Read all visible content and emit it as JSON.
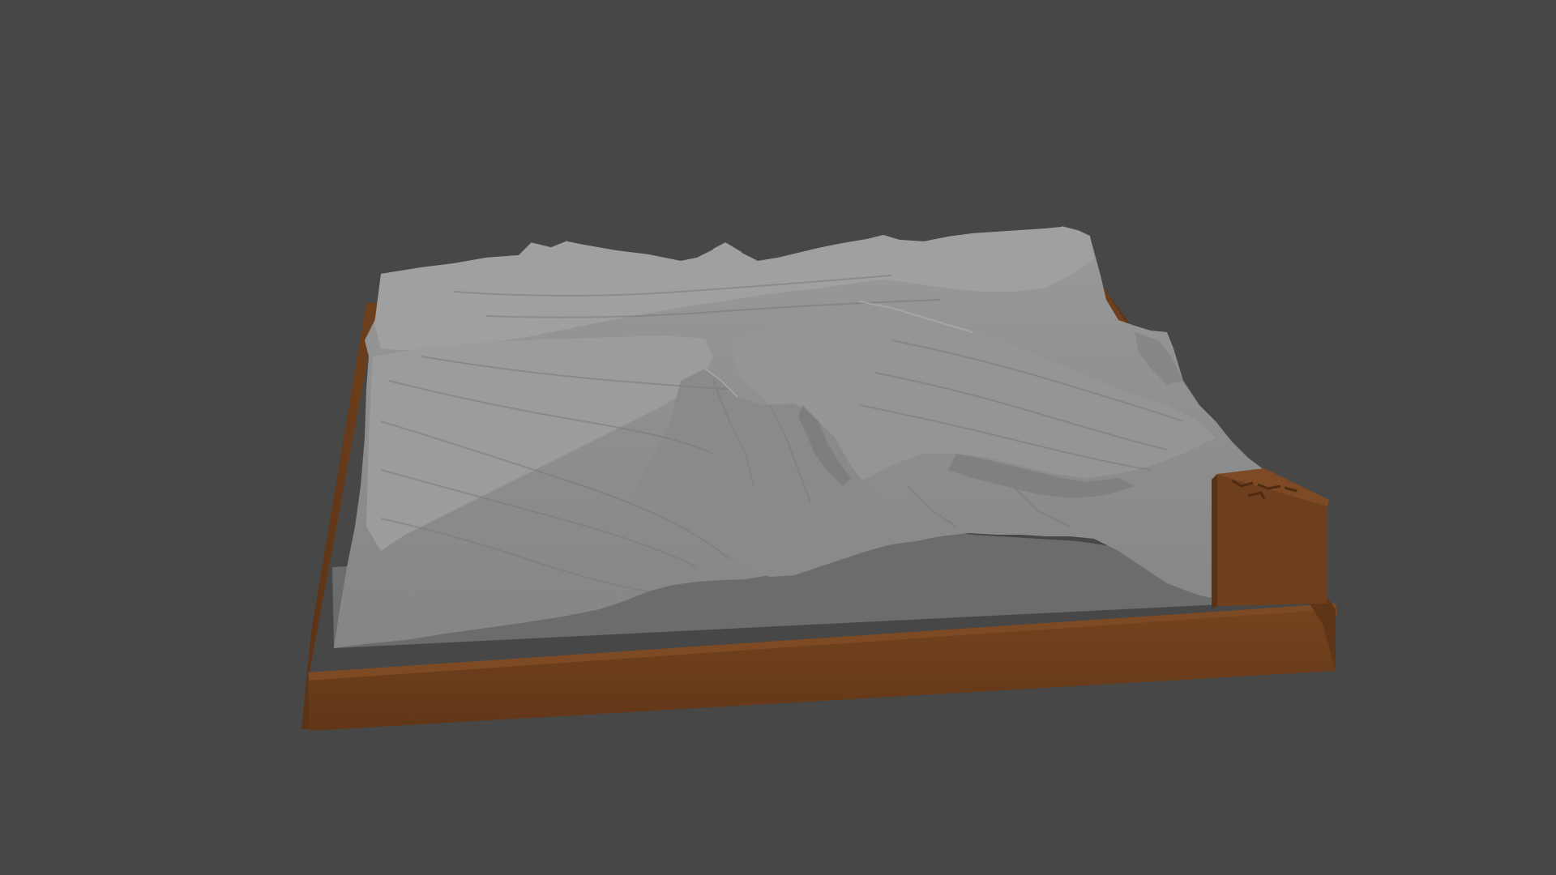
{
  "viewport": {
    "background_color": "#474747",
    "model": {
      "name": "terrain-relief-model",
      "base_color": "#6a3f1f",
      "terrain_color": "#8f8f8f",
      "floor_color": "#6b6c6c",
      "plaque_icon": "compass-north-arrow-icon"
    }
  }
}
